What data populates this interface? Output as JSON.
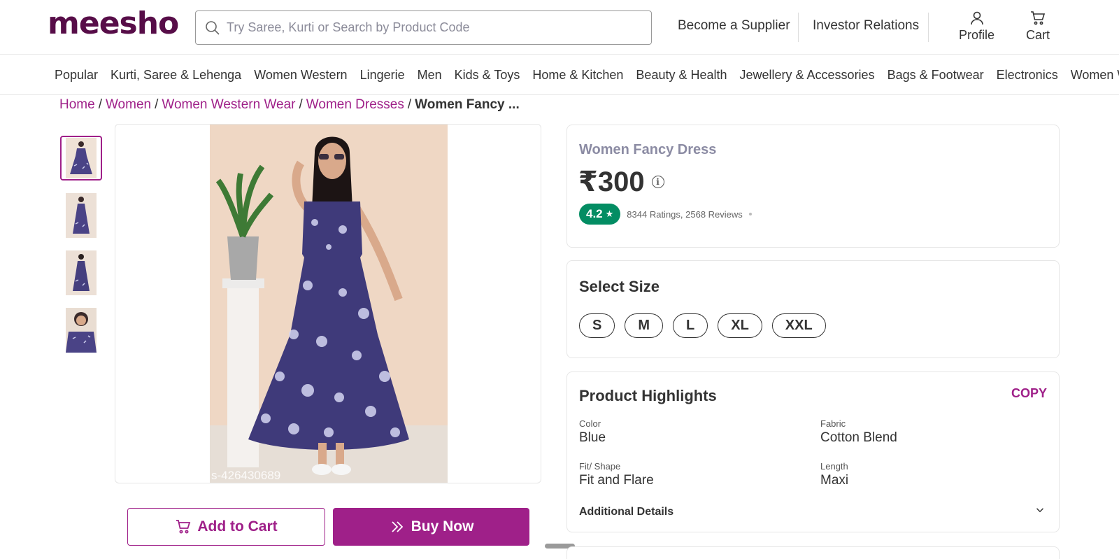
{
  "header": {
    "logo": "meesho",
    "search_placeholder": "Try Saree, Kurti or Search by Product Code",
    "links": [
      "Become a Supplier",
      "Investor Relations"
    ],
    "profile_label": "Profile",
    "cart_label": "Cart"
  },
  "categories": [
    "Popular",
    "Kurti, Saree & Lehenga",
    "Women Western",
    "Lingerie",
    "Men",
    "Kids & Toys",
    "Home & Kitchen",
    "Beauty & Health",
    "Jewellery & Accessories",
    "Bags & Footwear",
    "Electronics",
    "Women Western"
  ],
  "breadcrumb": {
    "items": [
      "Home",
      "Women",
      "Women Western Wear",
      "Women Dresses"
    ],
    "separator": "/",
    "current": "Women Fancy ..."
  },
  "gallery": {
    "watermark": "s-426430689"
  },
  "actions": {
    "add_to_cart": "Add to Cart",
    "buy_now": "Buy Now"
  },
  "product": {
    "name": "Women Fancy Dress",
    "price": "₹300",
    "info_icon": "i",
    "rating": "4.2",
    "rating_star": "★",
    "rating_text": "8344 Ratings, 2568 Reviews"
  },
  "size_section": {
    "title": "Select Size",
    "sizes": [
      "S",
      "M",
      "L",
      "XL",
      "XXL"
    ]
  },
  "highlights": {
    "title": "Product Highlights",
    "copy_label": "COPY",
    "attributes": [
      {
        "label": "Color",
        "value": "Blue"
      },
      {
        "label": "Fabric",
        "value": "Cotton Blend"
      },
      {
        "label": "Fit/ Shape",
        "value": "Fit and Flare"
      },
      {
        "label": "Length",
        "value": "Maxi"
      }
    ],
    "additional_details": "Additional Details"
  },
  "colors": {
    "brand": "#9f2089",
    "logo": "#570d48",
    "rating_green": "#038d63"
  }
}
